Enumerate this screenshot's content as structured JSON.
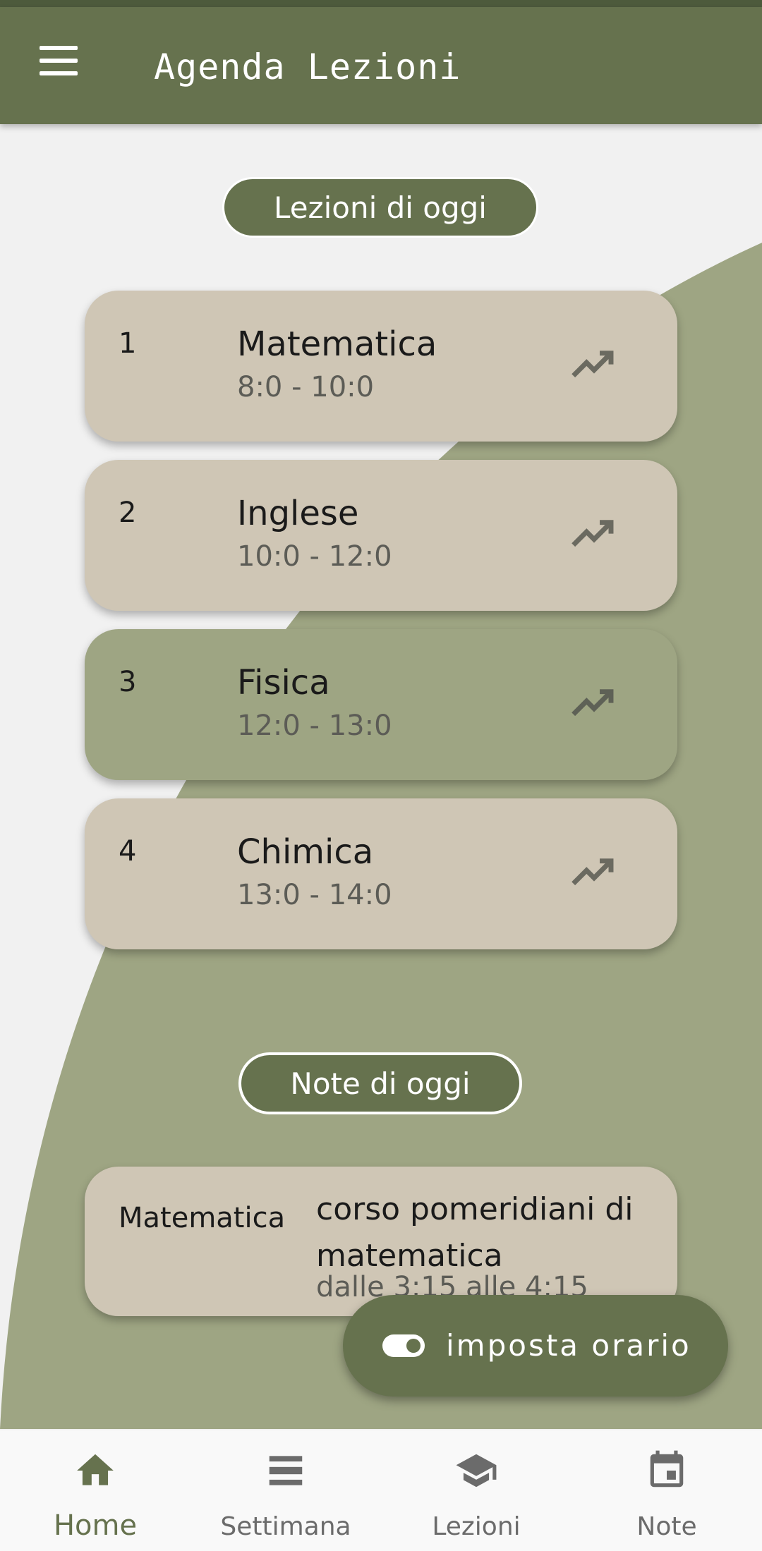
{
  "app": {
    "title": "Agenda Lezioni"
  },
  "colors": {
    "primary": "#66724e",
    "card": "#cfc6b5",
    "card_active": "#9ea583",
    "background_shape": "#9ea583"
  },
  "sections": {
    "today_lessons": "Lezioni di oggi",
    "today_notes": "Note di oggi"
  },
  "lessons": [
    {
      "number": "1",
      "subject": "Matematica",
      "time": "8:0 - 10:0",
      "icon": "trending-up-icon"
    },
    {
      "number": "2",
      "subject": "Inglese",
      "time": "10:0 - 12:0",
      "icon": "trending-up-icon"
    },
    {
      "number": "3",
      "subject": "Fisica",
      "time": "12:0 - 13:0",
      "icon": "trending-up-icon"
    },
    {
      "number": "4",
      "subject": "Chimica",
      "time": "13:0 - 14:0",
      "icon": "trending-up-icon"
    }
  ],
  "notes": [
    {
      "subject": "Matematica",
      "text": "corso pomeridiani di matematica",
      "time": "dalle 3:15 alle 4:15"
    }
  ],
  "fab": {
    "label": "imposta orario",
    "icon": "toggle-icon"
  },
  "nav": [
    {
      "label": "Home",
      "icon": "home-icon"
    },
    {
      "label": "Settimana",
      "icon": "list-icon"
    },
    {
      "label": "Lezioni",
      "icon": "school-icon"
    },
    {
      "label": "Note",
      "icon": "calendar-icon"
    }
  ]
}
